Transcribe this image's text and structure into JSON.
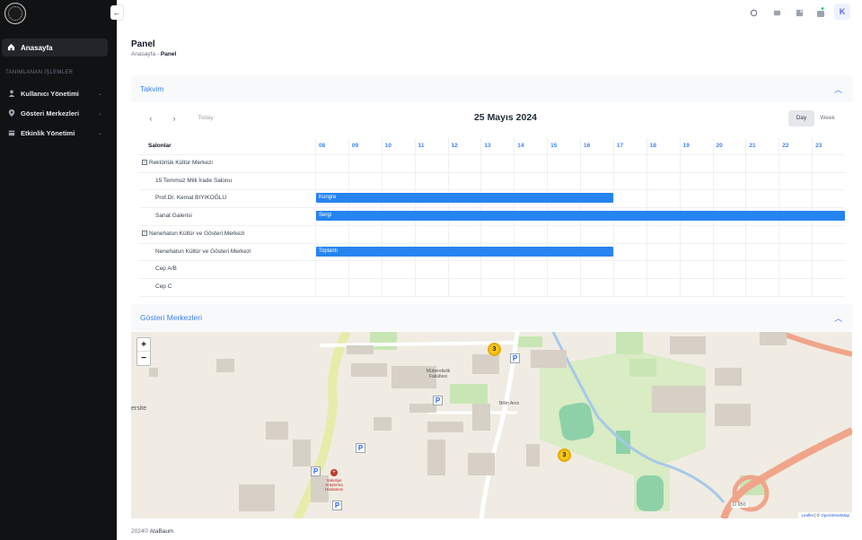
{
  "sidebar": {
    "home_label": "Anasayfa",
    "section_title": "TANIMLANAN İŞLEMLER",
    "items": [
      {
        "label": "Kullanıcı Yönetimi",
        "icon": "user-icon"
      },
      {
        "label": "Gösteri Merkezleri",
        "icon": "location-pin-icon"
      },
      {
        "label": "Etkinlik Yönetimi",
        "icon": "calendar-icon"
      }
    ],
    "toggle_glyph": "←"
  },
  "topbar": {
    "avatar_letter": "K",
    "icons": [
      "search-icon",
      "chat-icon",
      "grid-icon",
      "notification-icon"
    ]
  },
  "page": {
    "title": "Panel",
    "breadcrumb": {
      "parent": "Anasayfa",
      "separator": "-",
      "current": "Panel"
    }
  },
  "calendar": {
    "card_title": "Takvim",
    "prev_glyph": "‹",
    "next_glyph": "›",
    "today_label": "Today",
    "date_title": "25 Mayıs 2024",
    "views": [
      {
        "label": "Day",
        "active": true
      },
      {
        "label": "Week",
        "active": false
      }
    ],
    "resource_header": "Salonlar",
    "hours": [
      "08",
      "09",
      "10",
      "11",
      "12",
      "13",
      "14",
      "15",
      "16",
      "17",
      "18",
      "19",
      "20",
      "21",
      "22",
      "23"
    ],
    "groups": [
      {
        "name": "Rektörlük Kültür Merkezi",
        "rooms": [
          {
            "name": "15 Temmuz Milli İrade Salonu",
            "events": []
          },
          {
            "name": "Prof.Dr. Kemal BIYIKOĞLU",
            "events": [
              {
                "title": "Kongre",
                "start": 8,
                "end": 17
              }
            ]
          },
          {
            "name": "Sanat Galerisi",
            "events": [
              {
                "title": "Sergi",
                "start": 8,
                "end": 24
              }
            ]
          }
        ]
      },
      {
        "name": "Nenehatun Kültür ve Gösteri Merkezi",
        "rooms": [
          {
            "name": "Nenehatun Kültür ve Gösteri Merkezi",
            "events": [
              {
                "title": "Toplantı",
                "start": 8,
                "end": 17
              }
            ]
          },
          {
            "name": "Cep A/B",
            "events": []
          },
          {
            "name": "Cep C",
            "events": []
          }
        ]
      }
    ]
  },
  "map": {
    "card_title": "Gösteri Merkezleri",
    "zoom_in": "+",
    "zoom_out": "−",
    "clusters": [
      "3",
      "3"
    ],
    "labels": {
      "faculty": "Mühendislik Fakültesi",
      "monument": "Bilim Anıtı",
      "edge_text": "ersite",
      "hospital_line1": "Yakutiye",
      "hospital_line2": "Araştırma",
      "hospital_line3": "Hastanesi",
      "road": "D 950",
      "parking": "P"
    },
    "attribution": {
      "leaflet": "Leaflet",
      "sep": " | © ",
      "osm": "OpenStreetMap"
    }
  },
  "footer": {
    "year": "2024©",
    "company": "AtaBaum"
  }
}
